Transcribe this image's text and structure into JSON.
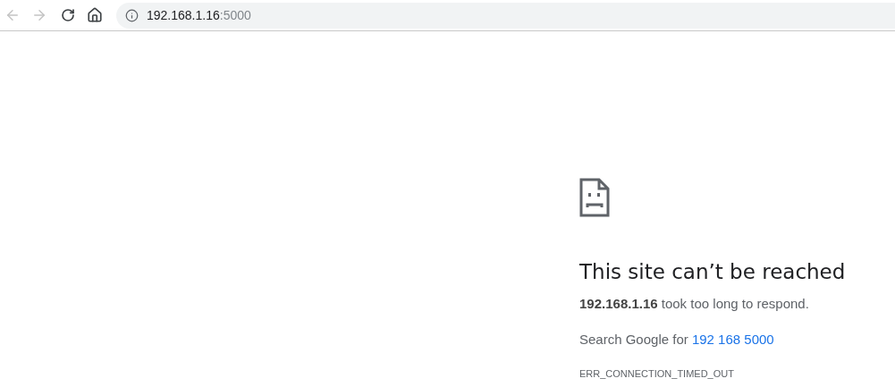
{
  "toolbar": {
    "back": {
      "disabled": true
    },
    "forward": {
      "disabled": true
    },
    "address": {
      "host": "192.168.1.16",
      "port": ":5000"
    }
  },
  "error": {
    "title": "This site can’t be reached",
    "message": "**192.168.1.16** took too long to respond.",
    "search_prefix": "Search Google for ",
    "search_link": "192 168 5000",
    "code": "ERR_CONNECTION_TIMED_OUT"
  }
}
